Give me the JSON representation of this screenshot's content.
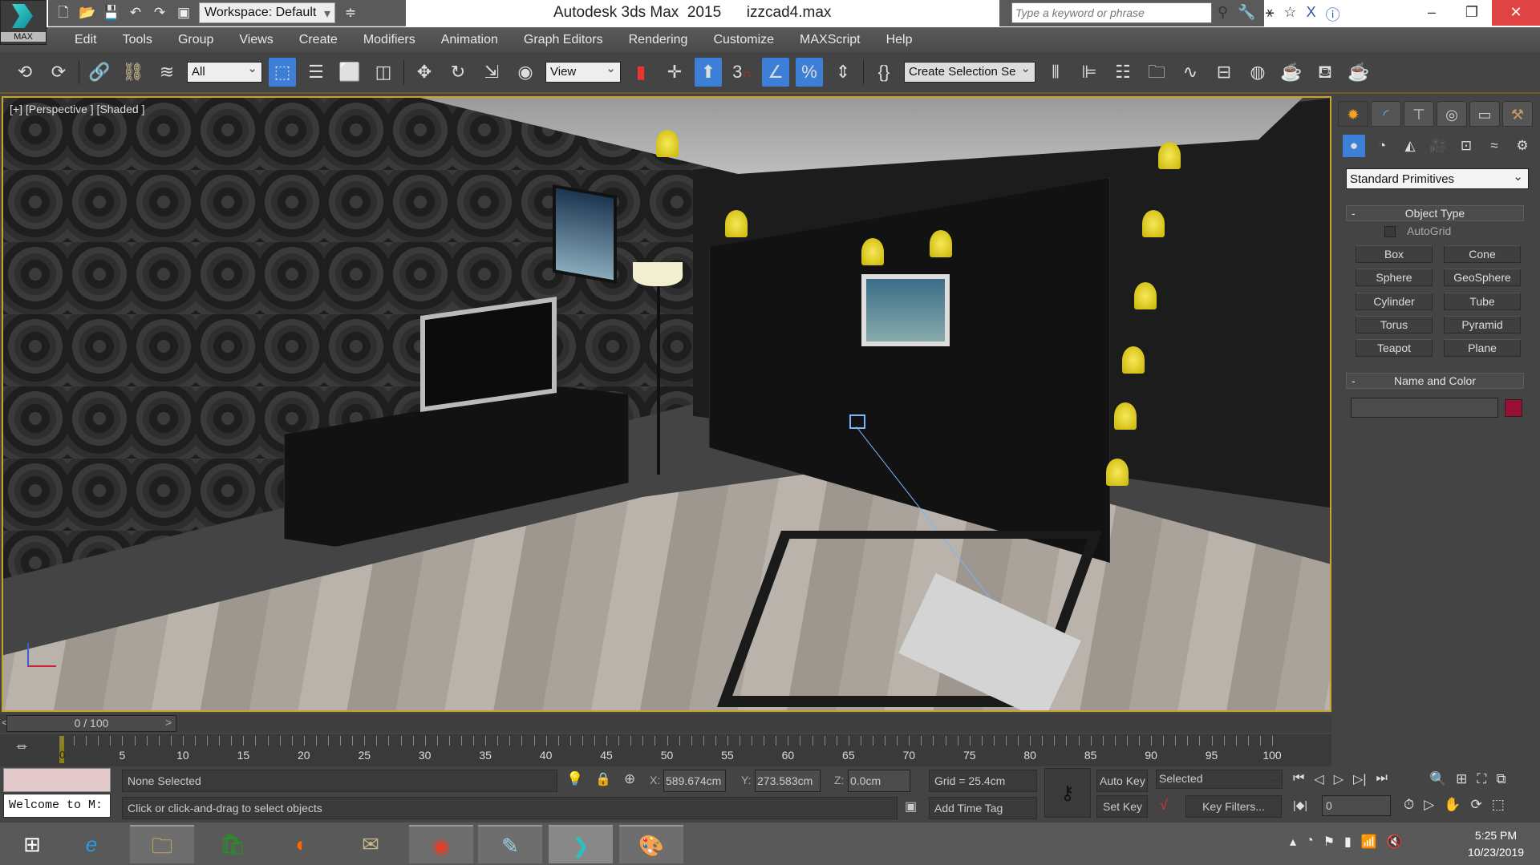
{
  "app": {
    "logo_label": "MAX",
    "title": "Autodesk 3ds Max  2015      izzcad4.max"
  },
  "quick_access": {
    "workspace": "Workspace: Default",
    "icons": [
      "new-file-icon",
      "open-file-icon",
      "save-icon",
      "undo-icon",
      "redo-icon",
      "project-folder-icon"
    ]
  },
  "search": {
    "placeholder": "Type a keyword or phrase"
  },
  "menu": [
    "Edit",
    "Tools",
    "Group",
    "Views",
    "Create",
    "Modifiers",
    "Animation",
    "Graph Editors",
    "Rendering",
    "Customize",
    "MAXScript",
    "Help"
  ],
  "toolbar": {
    "selection_filter": "All",
    "reference_coord": "View",
    "snap_label": "3",
    "named_selection": "Create Selection Se"
  },
  "viewport": {
    "label": "[+] [Perspective ] [Shaded ]",
    "border_color": "#c7a32a"
  },
  "command_panel": {
    "category": "Standard Primitives",
    "object_type_title": "Object Type",
    "autogrid": "AutoGrid",
    "buttons": [
      "Box",
      "Cone",
      "Sphere",
      "GeoSphere",
      "Cylinder",
      "Tube",
      "Torus",
      "Pyramid",
      "Teapot",
      "Plane"
    ],
    "name_color_title": "Name and Color",
    "object_color": "#9b0f35"
  },
  "time": {
    "slider": "0 / 100",
    "current_frame": 0,
    "ticks": [
      "5",
      "10",
      "15",
      "20",
      "25",
      "30",
      "35",
      "40",
      "45",
      "50",
      "55",
      "60",
      "65",
      "70",
      "75",
      "80",
      "85",
      "90",
      "95",
      "100"
    ],
    "first_tick": "0"
  },
  "status": {
    "maxscript_listener": "Welcome to M:",
    "selection": "None Selected",
    "prompt": "Click or click-and-drag to select objects",
    "x_label": "X:",
    "x": "589.674cm",
    "y_label": "Y:",
    "y": "273.583cm",
    "z_label": "Z:",
    "z": "0.0cm",
    "grid": "Grid = 25.4cm",
    "add_time_tag": "Add Time Tag",
    "auto_key": "Auto Key",
    "set_key": "Set Key",
    "key_mode": "Selected",
    "key_filters": "Key Filters...",
    "frame": "0"
  },
  "taskbar": {
    "time": "5:25 PM",
    "date": "10/23/2019"
  }
}
